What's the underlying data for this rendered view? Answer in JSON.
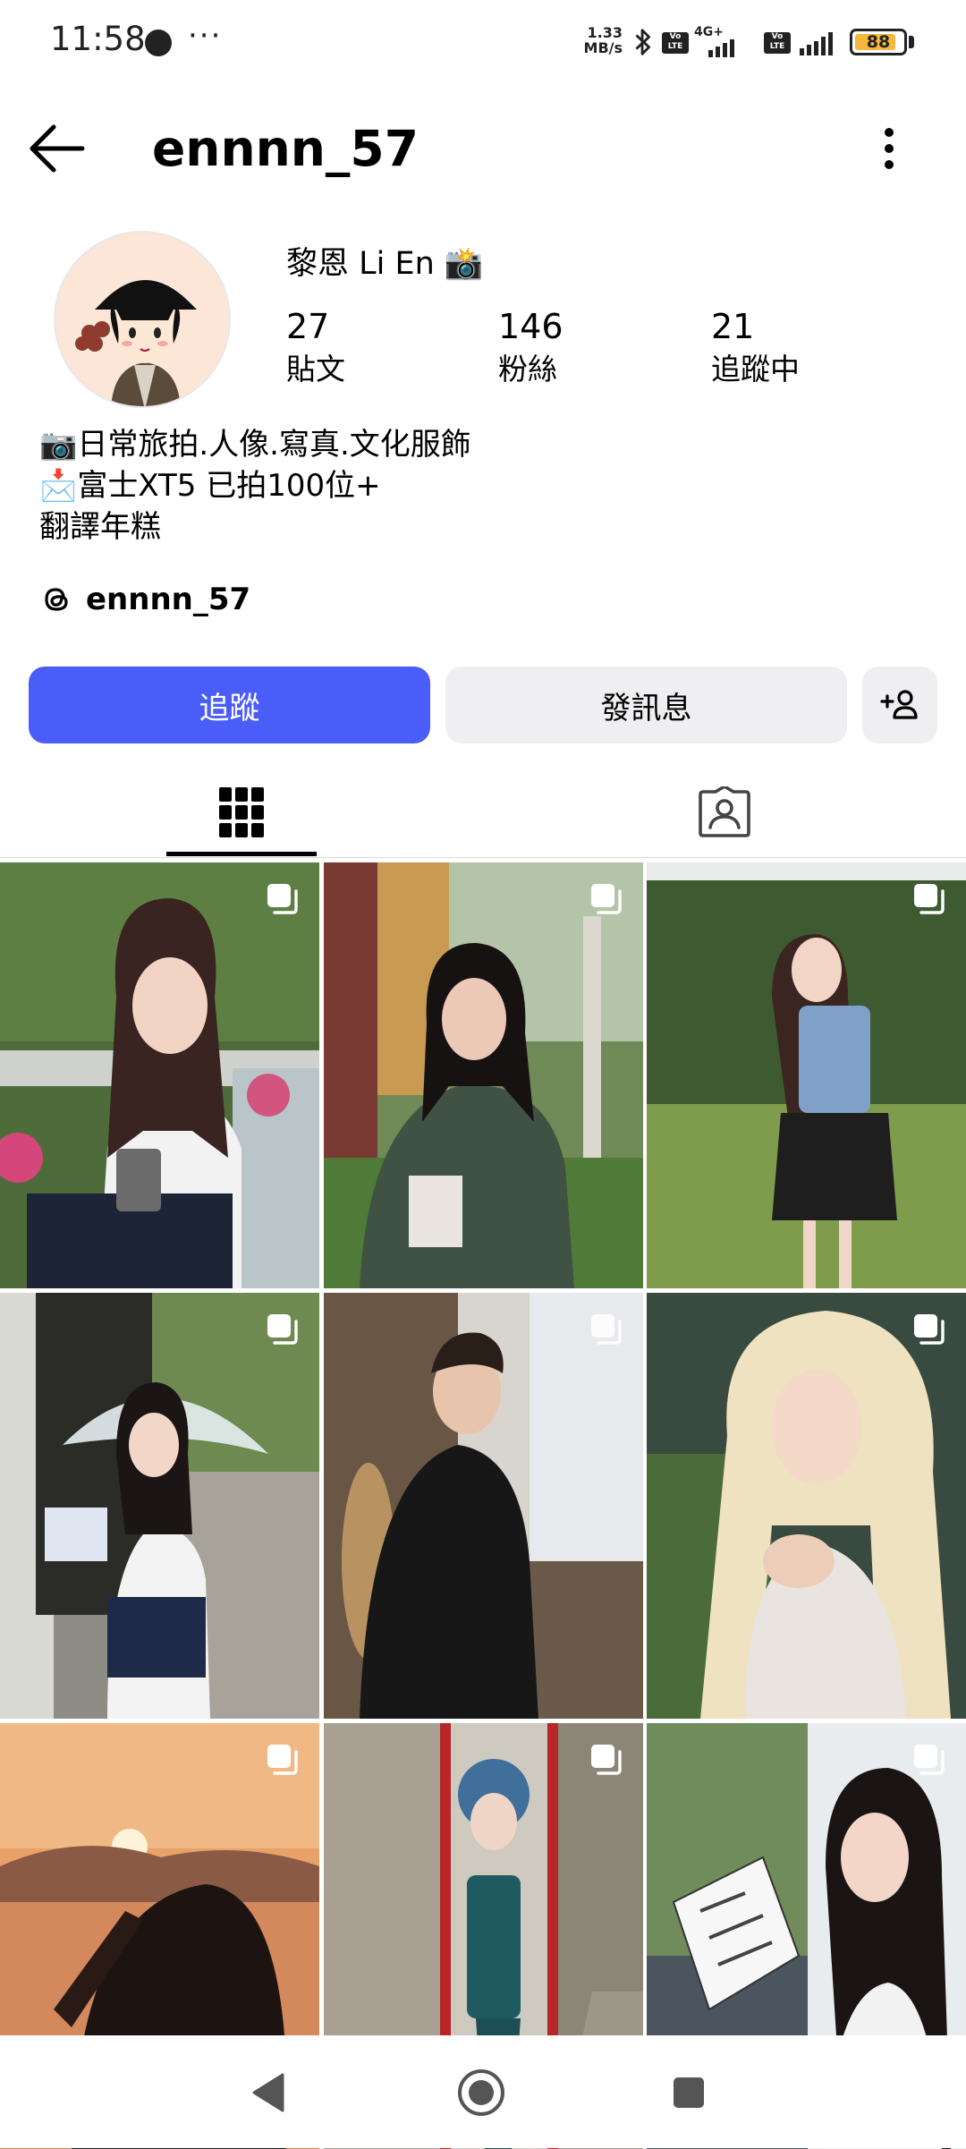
{
  "status_bar": {
    "time": "11:58",
    "net_speed_value": "1.33",
    "net_speed_unit": "MB/s",
    "network_label_1": "4G+",
    "volte_label": "Vo LTE",
    "battery_level": "88",
    "battery_percent": 88,
    "icons": [
      "record-dot-icon",
      "more-dots-icon",
      "bluetooth-icon",
      "volte-icon",
      "signal-icon",
      "battery-icon"
    ]
  },
  "header": {
    "username": "ennnn_57",
    "icons": [
      "back-arrow-icon",
      "more-vertical-icon"
    ]
  },
  "profile": {
    "display_name": "黎恩 Li En 📸",
    "stats": [
      {
        "value": "27",
        "label": "貼文"
      },
      {
        "value": "146",
        "label": "粉絲"
      },
      {
        "value": "21",
        "label": "追蹤中"
      }
    ],
    "bio": [
      "📷日常旅拍.人像.寫真.文化服飾",
      "📩富士XT5 已拍100位+",
      "翻譯年糕"
    ],
    "threads_handle": "ennnn_57"
  },
  "actions": {
    "follow_label": "追蹤",
    "message_label": "發訊息",
    "colors": {
      "follow_bg": "#4a5df9",
      "secondary_bg": "#efeff1"
    }
  },
  "tabs": [
    {
      "name": "grid-tab",
      "icon": "grid-icon",
      "active": true
    },
    {
      "name": "tagged-tab",
      "icon": "tagged-person-icon",
      "active": false
    }
  ],
  "posts": [
    {
      "subject": "girl-with-headphones-railing",
      "badge": "multi-photo-icon"
    },
    {
      "subject": "girl-green-shirt-garden",
      "badge": "multi-photo-icon"
    },
    {
      "subject": "girl-blue-shirt-lawn",
      "badge": "multi-photo-icon"
    },
    {
      "subject": "girl-umbrella-gate",
      "badge": "multi-photo-icon"
    },
    {
      "subject": "man-black-tshirt-cafe",
      "badge": "multi-photo-icon"
    },
    {
      "subject": "blonde-girl-portrait",
      "badge": "multi-photo-icon"
    },
    {
      "subject": "sunset-silhouette",
      "badge": "multi-photo-icon"
    },
    {
      "subject": "girl-blue-headdress-alley",
      "badge": "multi-photo-icon"
    },
    {
      "subject": "girl-reading-comic",
      "badge": "multi-photo-icon"
    }
  ],
  "nav_bar": {
    "icons": [
      "nav-back-icon",
      "nav-home-icon",
      "nav-recents-icon"
    ]
  }
}
